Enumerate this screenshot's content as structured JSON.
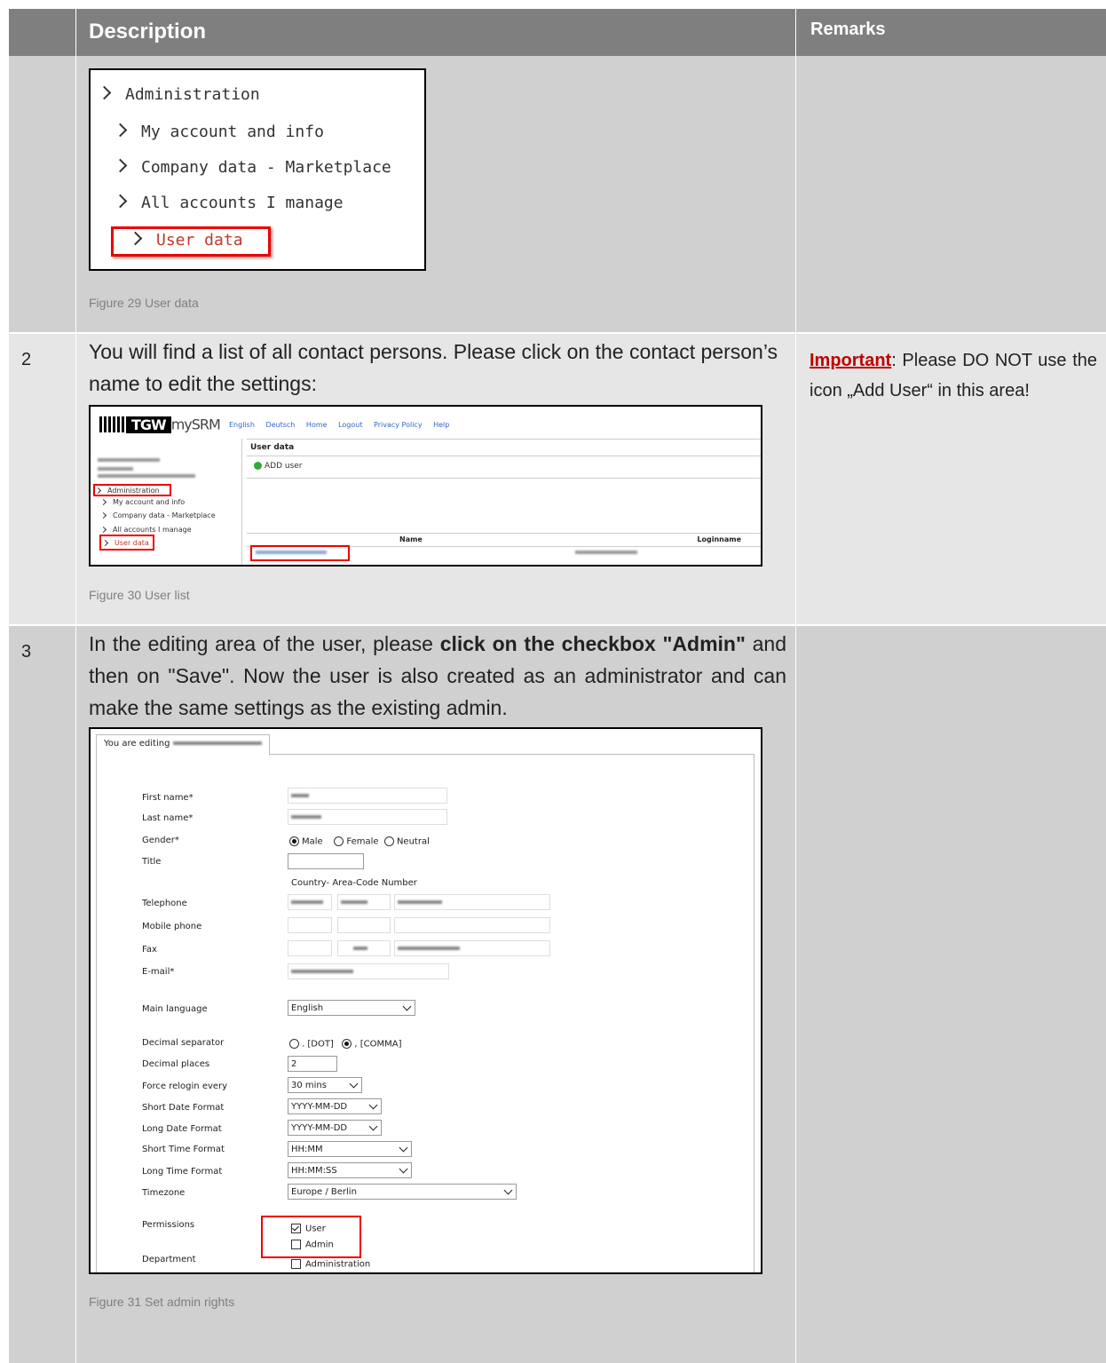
{
  "header": {
    "description": "Description",
    "remarks": "Remarks"
  },
  "rows": [
    {
      "number": "",
      "figure": {
        "items": [
          "Administration",
          "My account and info",
          "Company data - Marketplace",
          "All accounts I manage",
          "User data"
        ]
      },
      "caption": "Figure 29 User data",
      "remark": ""
    },
    {
      "number": "2",
      "text": "You will find a list of all contact persons. Please click on the contact person’s name to edit the settings:",
      "figure": {
        "logo_tgw": "TGW",
        "logo_mysrm": "mySRM",
        "nav_links": [
          "English",
          "Deutsch",
          "Home",
          "Logout",
          "Privacy Policy",
          "Help"
        ],
        "sidebar_items": [
          "Administration",
          "My account and info",
          "Company data - Marketplace",
          "All accounts I manage",
          "User data"
        ],
        "main_title": "User data",
        "add_user": "ADD user",
        "col_name": "Name",
        "col_login": "Loginname"
      },
      "caption": "Figure 30 User list",
      "remark_label": "Important",
      "remark_text": ": Please DO NOT use the icon „Add User“ in this area!"
    },
    {
      "number": "3",
      "text_before": "In the editing area of the user, please ",
      "text_bold": "click on the checkbox \"Admin\"",
      "text_after": " and then on \"Save\". Now the user is also created as an administrator and can make the same settings as the existing admin.",
      "figure": {
        "tab": "You are editing",
        "fields": {
          "first_name": "First name*",
          "last_name": "Last name*",
          "gender": "Gender*",
          "title": "Title",
          "phone_header": "Country- Area-Code Number",
          "telephone": "Telephone",
          "mobile": "Mobile phone",
          "fax": "Fax",
          "email": "E-mail*",
          "main_language": "Main language",
          "decimal_separator": "Decimal separator",
          "decimal_places": "Decimal places",
          "force_relogin": "Force relogin every",
          "short_date": "Short Date Format",
          "long_date": "Long Date Format",
          "short_time": "Short Time Format",
          "long_time": "Long Time Format",
          "timezone": "Timezone",
          "permissions": "Permissions",
          "department": "Department"
        },
        "gender_options": [
          "Male",
          "Female",
          "Neutral"
        ],
        "gender_selected": "Male",
        "values": {
          "main_language": "English",
          "decimal_dot": ". [DOT]",
          "decimal_comma": ", [COMMA]",
          "decimal_places": "2",
          "force_relogin": "30 mins",
          "short_date": "YYYY-MM-DD",
          "long_date": "YYYY-MM-DD",
          "short_time": "HH:MM",
          "long_time": "HH:MM:SS",
          "timezone": "Europe / Berlin"
        },
        "permissions": [
          {
            "label": "User",
            "checked": true
          },
          {
            "label": "Admin",
            "checked": false
          }
        ],
        "department": "Administration"
      },
      "caption": "Figure 31 Set admin rights",
      "remark": ""
    }
  ],
  "colors": {
    "header_bg": "#7f7f7f",
    "important": "#c00000",
    "highlight_box": "#e00000"
  }
}
